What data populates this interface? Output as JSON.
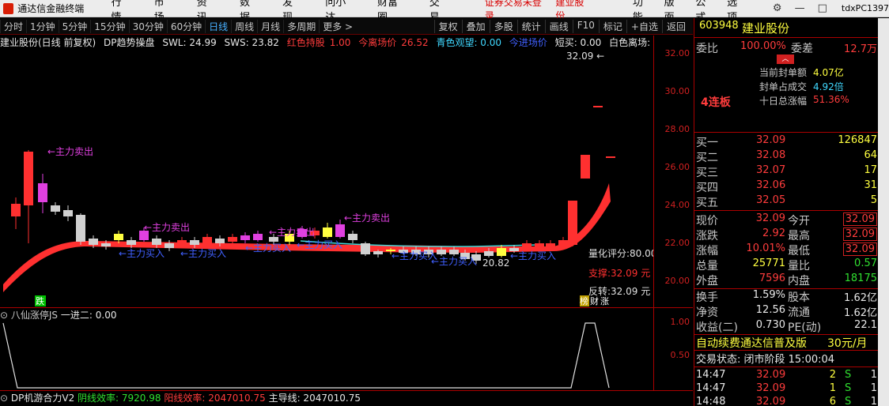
{
  "titlebar": {
    "app_name": "通达信金融终端",
    "menu": [
      "行情",
      "市场",
      "资讯",
      "数据",
      "发现",
      "问小达",
      "财富圈",
      "交易"
    ],
    "status_warn": "证券交易未登录",
    "status_stock": "建业股份",
    "menu2": [
      "功能",
      "版面",
      "公式",
      "选项"
    ],
    "user": "tdxPC1397"
  },
  "periodbar": {
    "items": [
      "分时",
      "1分钟",
      "5分钟",
      "15分钟",
      "30分钟",
      "60分钟",
      "日线",
      "周线",
      "月线",
      "多周期",
      "更多 >"
    ],
    "active": "日线",
    "right": [
      "复权",
      "叠加",
      "多股",
      "统计",
      "画线",
      "F10",
      "标记",
      "+自选",
      "返回"
    ]
  },
  "infoline": {
    "name": "建业股份(日线 前复权)",
    "ind": "DP趋势操盘",
    "swl": "SWL: 24.99",
    "sws": "SWS: 23.82",
    "red_hold": "红色持股",
    "red_hold_val": "1.00",
    "today_leave": "今离场价",
    "today_leave_val": "26.52",
    "cyan_watch": "青色观望: 0.00",
    "today_enter": "今进场价",
    "short": "短买: 0.00",
    "white_leave": "白色离场: 0.",
    "price_top": "32.09"
  },
  "yaxis": [
    "32.00",
    "30.00",
    "28.00",
    "26.00",
    "24.00",
    "22.00",
    "20.00"
  ],
  "annotations": {
    "sell": "主力卖出",
    "buy": "主力买入",
    "low": "20.82",
    "score": "量化评分:80.00",
    "support": "支撑:32.09 元",
    "reverse": "反转:32.09 元",
    "tag_die": "跌",
    "tag_bang": "榜",
    "tag_cai": "财",
    "tag_zhang": "涨"
  },
  "pane2": {
    "title": "八仙涨停JS",
    "line": "一进二: 0.00",
    "ticks": [
      "1.00",
      "0.50"
    ]
  },
  "pane3": {
    "title": "DP机游合力V2",
    "yin": "阴线效率: 7920.98",
    "yang": "阳线效率: 2047010.75",
    "main": "主导线: 2047010.75"
  },
  "quote": {
    "code": "603948",
    "name": "建业股份",
    "weibi_label": "委比",
    "weibi": "100.00%",
    "weicha_label": "委差",
    "weicha": "12.7万",
    "seal_amt_label": "当前封单额",
    "seal_amt": "4.07亿",
    "seal_ratio_label": "封单占成交",
    "seal_ratio": "4.92倍",
    "ten_day_label": "十日总涨幅",
    "ten_day": "51.36%",
    "streak": "4连板",
    "buy_labels": [
      "买一",
      "买二",
      "买三",
      "买四",
      "买五"
    ],
    "buy_prices": [
      "32.09",
      "32.08",
      "32.07",
      "32.06",
      "32.05"
    ],
    "buy_vols": [
      "126847",
      "64",
      "17",
      "31",
      "5"
    ],
    "stats": [
      {
        "l": "现价",
        "v": "32.09",
        "l2": "今开",
        "v2": "32.09"
      },
      {
        "l": "涨跌",
        "v": "2.92",
        "l2": "最高",
        "v2": "32.09"
      },
      {
        "l": "涨幅",
        "v": "10.01%",
        "l2": "最低",
        "v2": "32.09"
      },
      {
        "l": "总量",
        "v": "25771",
        "l2": "量比",
        "v2": "0.57"
      },
      {
        "l": "外盘",
        "v": "7596",
        "l2": "内盘",
        "v2": "18175"
      }
    ],
    "stats2": [
      {
        "l": "换手",
        "v": "1.59%",
        "l2": "股本",
        "v2": "1.62亿"
      },
      {
        "l": "净资",
        "v": "12.56",
        "l2": "流通",
        "v2": "1.62亿"
      },
      {
        "l": "收益(二)",
        "v": "0.730",
        "l2": "PE(动)",
        "v2": "22.1"
      }
    ],
    "ad": "自动续费通达信普及版",
    "ad_price": "30元/月",
    "trade_status": "交易状态: 闭市阶段 15:00:04",
    "ticks": [
      {
        "t": "14:47",
        "p": "32.09",
        "v": "2",
        "s": "S",
        "n": "1"
      },
      {
        "t": "14:47",
        "p": "32.09",
        "v": "1",
        "s": "S",
        "n": "1"
      },
      {
        "t": "14:48",
        "p": "32.09",
        "v": "6",
        "s": "S",
        "n": "1"
      }
    ]
  },
  "colors": {
    "up": "#ff3c3c",
    "down": "#30e0e0",
    "bg": "#000000",
    "grid": "#a00000"
  }
}
